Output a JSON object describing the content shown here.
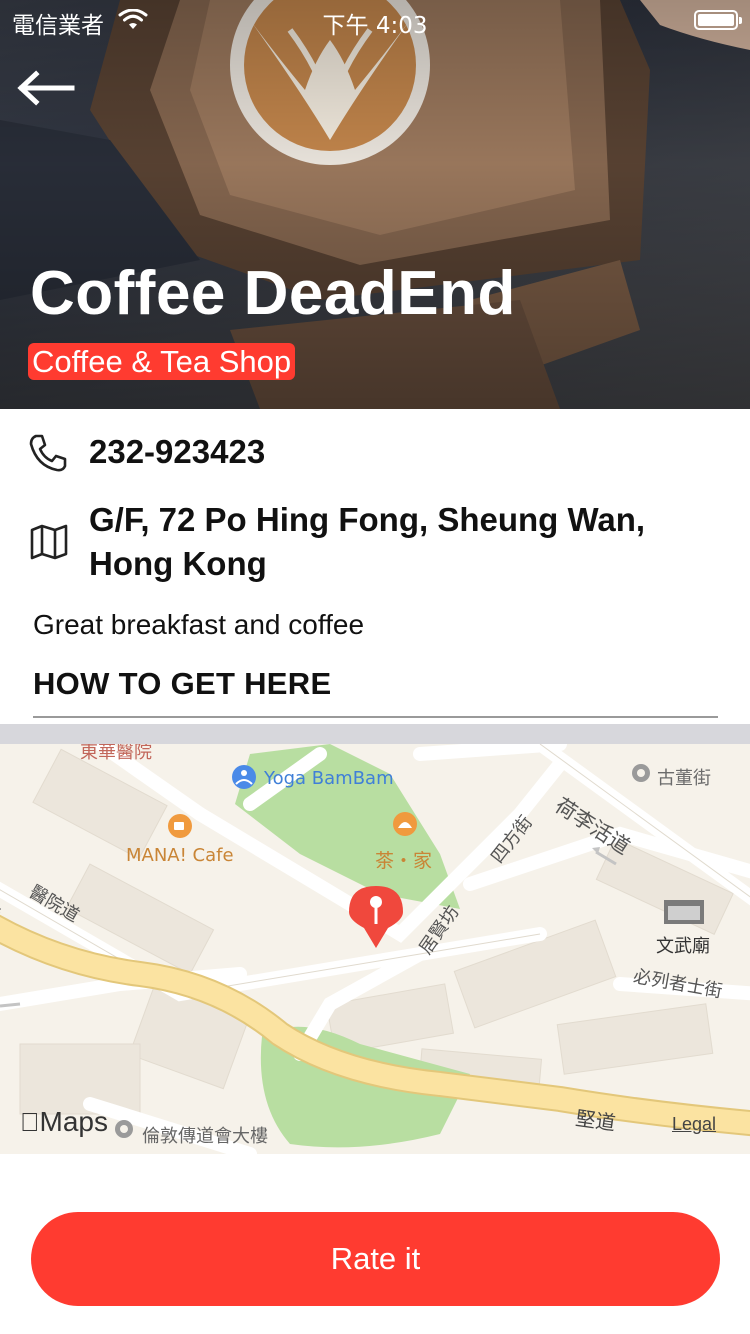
{
  "status_bar": {
    "carrier": "電信業者",
    "time": "下午 4:03"
  },
  "hero": {
    "title": "Coffee DeadEnd",
    "category": "Coffee & Tea Shop"
  },
  "info": {
    "phone": "232-923423",
    "address": "G/F, 72 Po Hing Fong, Sheung Wan, Hong Kong",
    "description": "Great breakfast and coffee",
    "directions_heading": "HOW TO GET HERE"
  },
  "map": {
    "labels": {
      "top": "東華醫院",
      "yoga": "Yoga BamBam",
      "mana": "MANA! Cafe",
      "tea": "茶・家",
      "guhai": "古董街",
      "wenwu": "文武廟",
      "holly": "荷李活道",
      "sifang": "四方街",
      "jixian": "居賢坊",
      "yiyuan": "醫院道",
      "bilie": "必列者士街",
      "jiandao": "堅道",
      "lundon": "倫敦傳道會大樓",
      "left": "道"
    },
    "logo": "Maps",
    "legal": "Legal",
    "colors": {
      "background": "#f6f2ea",
      "park": "#b8dea1",
      "major_road": "#fbe3a1",
      "pin": "#f0483d"
    }
  },
  "actions": {
    "rate_label": "Rate it"
  },
  "colors": {
    "accent": "#ff3b30"
  }
}
